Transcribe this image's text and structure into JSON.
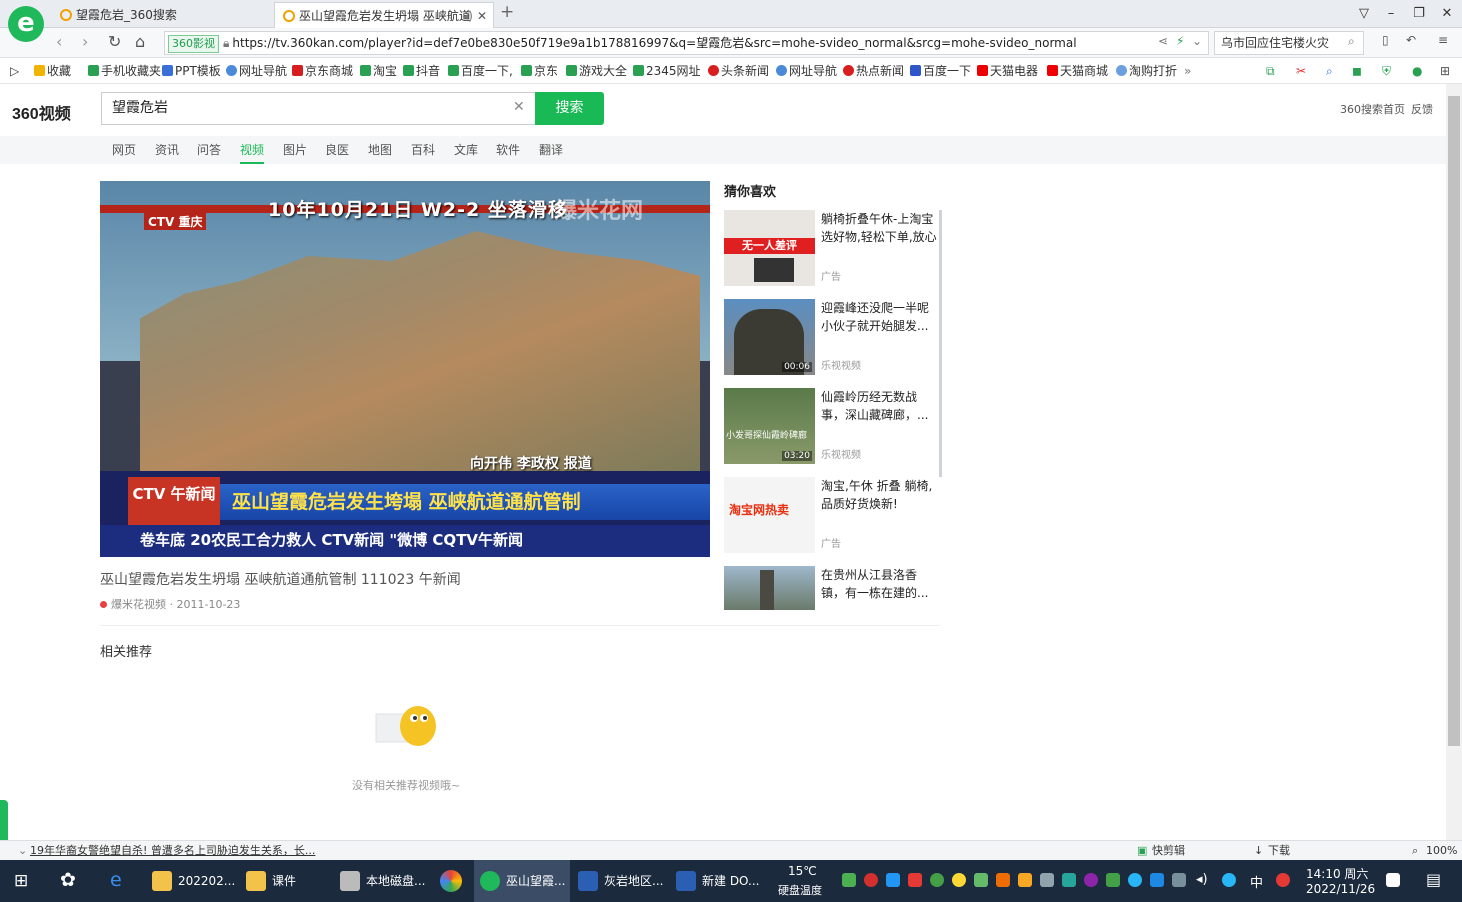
{
  "browser": {
    "tabs": [
      {
        "label": "望霞危岩_360搜索",
        "active": false
      },
      {
        "label": "巫山望霞危岩发生坍塌 巫峡航道",
        "active": true
      }
    ],
    "new_tab": "+",
    "url_badge": "360影视",
    "url": "https://tv.360kan.com/player?id=def7e0be830e50f719e9a1b178816997&q=望霞危岩&src=mohe-svideo_normal&srcg=mohe-svideo_normal",
    "right_search": "乌市回应住宅楼火灾",
    "window_buttons": [
      "▽",
      "–",
      "❐",
      "✕"
    ]
  },
  "bookmarks": [
    {
      "label": "收藏",
      "color": "#f0b400"
    },
    {
      "label": "手机收藏夹",
      "color": "#2aa052"
    },
    {
      "label": "PPT模板",
      "color": "#3a6fd8"
    },
    {
      "label": "网址导航",
      "color": "#4a8ad8"
    },
    {
      "label": "京东商城",
      "color": "#d81e1e"
    },
    {
      "label": "淘宝",
      "color": "#2aa052"
    },
    {
      "label": "抖音",
      "color": "#2aa052"
    },
    {
      "label": "百度一下,",
      "color": "#2aa052"
    },
    {
      "label": "京东",
      "color": "#2aa052"
    },
    {
      "label": "游戏大全",
      "color": "#2aa052"
    },
    {
      "label": "2345网址",
      "color": "#2aa052"
    },
    {
      "label": "头条新闻",
      "color": "#d81e1e"
    },
    {
      "label": "网址导航",
      "color": "#4a8ad8"
    },
    {
      "label": "热点新闻",
      "color": "#d81e1e"
    },
    {
      "label": "百度一下",
      "color": "#2f56c8"
    },
    {
      "label": "天猫电器",
      "color": "#e00"
    },
    {
      "label": "天猫商城",
      "color": "#e00"
    },
    {
      "label": "淘购打折",
      "color": "#6aa0e0"
    }
  ],
  "bookmark_more": "»",
  "site": {
    "logo": "360视频",
    "query": "望霞危岩",
    "search_button": "搜索",
    "links": [
      "360搜索首页",
      "反馈"
    ],
    "categories": [
      "网页",
      "资讯",
      "问答",
      "视频",
      "图片",
      "良医",
      "地图",
      "百科",
      "文库",
      "软件",
      "翻译"
    ],
    "active_category": "视频"
  },
  "video": {
    "overlay_top": "10年10月21日 W2-2 坐落滑移",
    "watermark": "爆米花网",
    "station": "CTV 重庆",
    "reporters": "向开伟 李政权 报道",
    "banner_logo": "CTV 午新闻",
    "banner": "巫山望霞危岩发生垮塌 巫峡航道通航管制",
    "ticker": "卷车底 20农民工合力救人   CTV新闻   \"微博 CQTV午新闻",
    "title": "巫山望霞危岩发生坍塌 巫峡航道通航管制 111023 午新闻",
    "source": "爆米花视频 · 2011-10-23"
  },
  "related": {
    "heading": "相关推荐",
    "empty": "没有相关推荐视频哦~"
  },
  "guess": {
    "heading": "猜你喜欢",
    "items": [
      {
        "title": "躺椅折叠午休-上淘宝选好物,轻松下单,放心购...",
        "source": "广告",
        "duration": ""
      },
      {
        "title": "迎霞峰还没爬一半呢 小伙子就开始腿发...",
        "source": "乐视视频",
        "duration": "00:06"
      },
      {
        "title": "仙霞岭历经无数战事，深山藏碑廊，...",
        "source": "乐视视频",
        "duration": "03:20"
      },
      {
        "title": "淘宝,午休 折叠 躺椅,品质好货焕新!",
        "source": "广告",
        "duration": ""
      },
      {
        "title": "在贵州从江县洛香镇，有一栋在建的...",
        "source": "",
        "duration": ""
      }
    ],
    "thumb_texts": [
      "无一人差评",
      "淘宝网热卖",
      "小发哥探仙霞岭碑廊"
    ]
  },
  "status": {
    "news": "19年华裔女警绝望自杀! 曾遭多名上司胁迫发生关系，长...",
    "items": [
      "快剪辑",
      "下载",
      "100%"
    ]
  },
  "taskbar": {
    "apps": [
      "202202...",
      "课件",
      "本地磁盘...",
      "巫山望霞...",
      "灰岩地区...",
      "新建 DO..."
    ],
    "weather": "15℃",
    "weather_sub": "硬盘温度",
    "ime": "中",
    "time": "14:10 周六",
    "date": "2022/11/26"
  }
}
